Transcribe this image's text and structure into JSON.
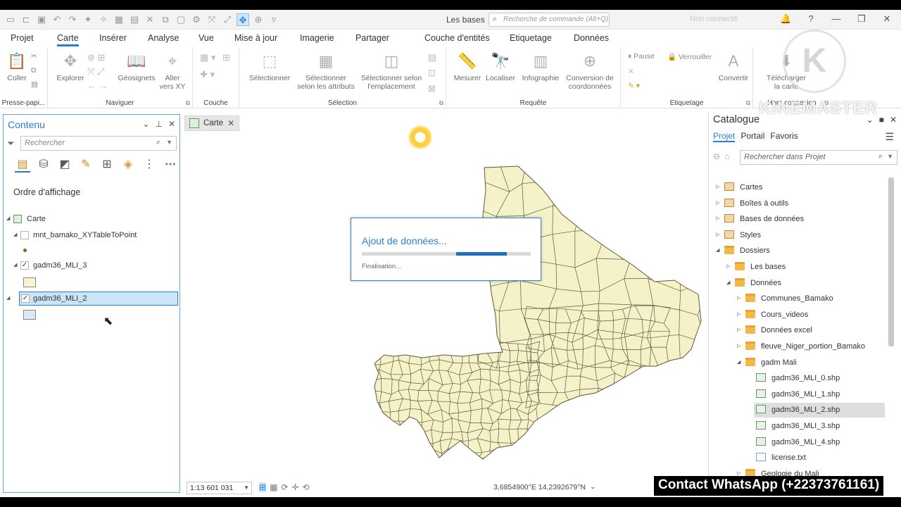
{
  "titlebar": {
    "project_name": "Les bases",
    "command_search_placeholder": "Recherche de commande (Alt+Q)",
    "user_status": "Non connecté"
  },
  "tabs": [
    "Projet",
    "Carte",
    "Insérer",
    "Analyse",
    "Vue",
    "Mise à jour",
    "Imagerie",
    "Partager"
  ],
  "context_tabs": [
    "Couche d'entités",
    "Etiquetage",
    "Données"
  ],
  "ribbon": {
    "clipboard": {
      "paste": "Coller",
      "group": "Presse-papi..."
    },
    "navigate": {
      "explore": "Explorer",
      "bookmarks": "Géosignets",
      "goto_l1": "Aller",
      "goto_l2": "vers XY",
      "group": "Naviguer"
    },
    "layer": {
      "group": "Couche"
    },
    "selection": {
      "select": "Sélectionner",
      "by_attr_l1": "Sélectionner",
      "by_attr_l2": "selon les attributs",
      "by_loc_l1": "Sélectionner selon",
      "by_loc_l2": "l'emplacement",
      "group": "Sélection"
    },
    "inquiry": {
      "measure": "Mesurer",
      "locate": "Localiser",
      "infographic": "Infographie",
      "convert_l1": "Conversion de",
      "convert_l2": "coordonnées",
      "group": "Requête"
    },
    "labeling": {
      "pause": "Pause",
      "lock": "Verrouiller",
      "convert": "Convertir",
      "group": "Etiquetage"
    },
    "offline": {
      "download_l1": "Télécharger",
      "download_l2": "la carte",
      "group": "Hors connexion"
    }
  },
  "contents": {
    "title": "Contenu",
    "search_placeholder": "Rechercher",
    "order_label": "Ordre d'affichage",
    "map_name": "Carte",
    "layers": [
      {
        "name": "mnt_bamako_XYTableToPoint",
        "checked": false
      },
      {
        "name": "gadm36_MLI_3",
        "checked": true
      },
      {
        "name": "gadm36_MLI_2",
        "checked": true,
        "selected": true
      }
    ]
  },
  "map": {
    "tab_label": "Carte",
    "scale": "1:13 601 031",
    "coordinates": "3,6854900°E 14,2392679°N",
    "fill_color": "#f5f2c9",
    "stroke_color": "#5a5a3c",
    "progress": {
      "title": "Ajout de données...",
      "status": "Finalisation...",
      "fraction": 0.3
    }
  },
  "catalog": {
    "title": "Catalogue",
    "tabs": [
      "Projet",
      "Portail",
      "Favoris"
    ],
    "search_placeholder": "Rechercher dans Projet",
    "items": [
      {
        "label": "Cartes",
        "level": 0,
        "icon": "gen",
        "twisty": "▷"
      },
      {
        "label": "Boîtes à outils",
        "level": 0,
        "icon": "gen",
        "twisty": "▷"
      },
      {
        "label": "Bases de données",
        "level": 0,
        "icon": "gen",
        "twisty": "▷"
      },
      {
        "label": "Styles",
        "level": 0,
        "icon": "gen",
        "twisty": "▷"
      },
      {
        "label": "Dossiers",
        "level": 0,
        "icon": "folder",
        "twisty": "◢"
      },
      {
        "label": "Les bases",
        "level": 1,
        "icon": "folder",
        "twisty": "▷"
      },
      {
        "label": "Données",
        "level": 1,
        "icon": "folder",
        "twisty": "◢"
      },
      {
        "label": "Communes_Bamako",
        "level": 2,
        "icon": "folder",
        "twisty": "▷"
      },
      {
        "label": "Cours_videos",
        "level": 2,
        "icon": "folder",
        "twisty": "▷"
      },
      {
        "label": "Données excel",
        "level": 2,
        "icon": "folder",
        "twisty": "▷"
      },
      {
        "label": "fleuve_Niger_portion_Bamako",
        "level": 2,
        "icon": "folder",
        "twisty": "▷"
      },
      {
        "label": "gadm Mali",
        "level": 2,
        "icon": "folder",
        "twisty": "◢"
      },
      {
        "label": "gadm36_MLI_0.shp",
        "level": 3,
        "icon": "shp",
        "twisty": ""
      },
      {
        "label": "gadm36_MLI_1.shp",
        "level": 3,
        "icon": "shp",
        "twisty": ""
      },
      {
        "label": "gadm36_MLI_2.shp",
        "level": 3,
        "icon": "shp",
        "twisty": "",
        "selected": true
      },
      {
        "label": "gadm36_MLI_3.shp",
        "level": 3,
        "icon": "shp",
        "twisty": ""
      },
      {
        "label": "gadm36_MLI_4.shp",
        "level": 3,
        "icon": "shp",
        "twisty": ""
      },
      {
        "label": "license.txt",
        "level": 3,
        "icon": "txt",
        "twisty": ""
      },
      {
        "label": "Geologie du Mali",
        "level": 2,
        "icon": "folder",
        "twisty": "▷"
      }
    ]
  },
  "overlay": {
    "watermark": "KINEMASTER",
    "logo_letter": "K",
    "contact": "Contact WhatsApp (+22373761161)"
  },
  "colors": {
    "accent": "#2b7dd1",
    "selection": "#cce4f7"
  }
}
